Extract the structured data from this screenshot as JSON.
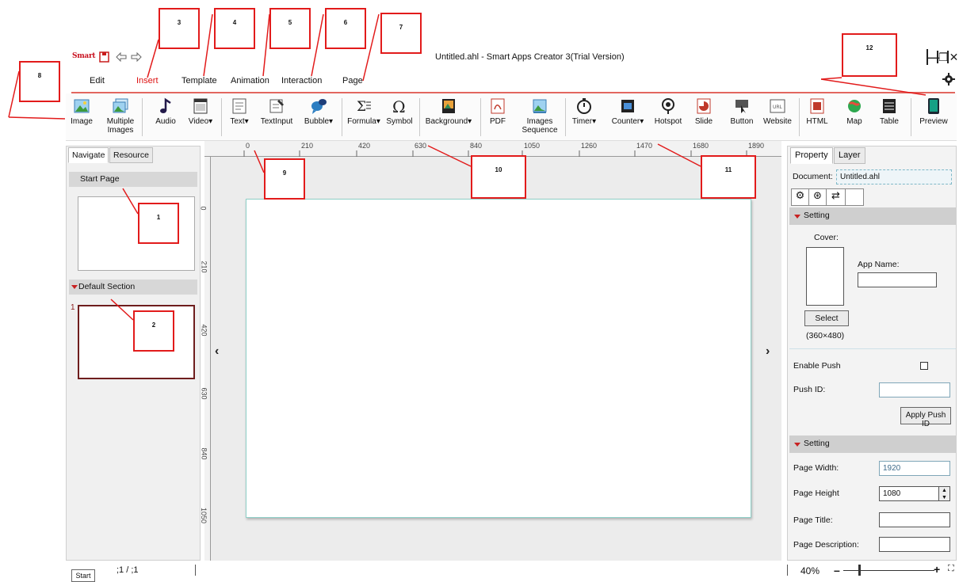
{
  "window": {
    "logo_text": "Smart",
    "title": "Untitled.ahl - Smart Apps Creator 3(Trial Version)",
    "controls": [
      "—",
      "❐",
      "✕"
    ]
  },
  "quick_access": [
    "save-icon",
    "undo-icon",
    "redo-icon"
  ],
  "menu_tabs": [
    {
      "label": "Edit",
      "active": false
    },
    {
      "label": "Insert",
      "active": true
    },
    {
      "label": "Template",
      "active": false
    },
    {
      "label": "Animation",
      "active": false
    },
    {
      "label": "Interaction",
      "active": false
    },
    {
      "label": "Page",
      "active": false
    }
  ],
  "toolbar": [
    {
      "label": "Image",
      "icon": "image-icon"
    },
    {
      "label": "Multiple\nImages",
      "icon": "multiple-images-icon"
    },
    {
      "label": "Audio",
      "icon": "audio-icon"
    },
    {
      "label": "Video▾",
      "icon": "video-icon"
    },
    {
      "label": "Text▾",
      "icon": "text-icon"
    },
    {
      "label": "TextInput",
      "icon": "text-input-icon"
    },
    {
      "label": "Bubble▾",
      "icon": "bubble-icon"
    },
    {
      "label": "Formula▾",
      "icon": "formula-icon"
    },
    {
      "label": "Symbol",
      "icon": "symbol-icon"
    },
    {
      "label": "Background▾",
      "icon": "background-icon"
    },
    {
      "label": "PDF",
      "icon": "pdf-icon"
    },
    {
      "label": "Images\nSequence",
      "icon": "images-sequence-icon"
    },
    {
      "label": "Timer▾",
      "icon": "timer-icon"
    },
    {
      "label": "Counter▾",
      "icon": "counter-icon"
    },
    {
      "label": "Hotspot",
      "icon": "hotspot-icon"
    },
    {
      "label": "Slide",
      "icon": "slide-icon"
    },
    {
      "label": "Button",
      "icon": "button-icon"
    },
    {
      "label": "Website",
      "icon": "website-icon"
    },
    {
      "label": "HTML",
      "icon": "html-icon"
    },
    {
      "label": "Map",
      "icon": "map-icon"
    },
    {
      "label": "Table",
      "icon": "table-icon"
    },
    {
      "label": "Preview",
      "icon": "preview-icon"
    }
  ],
  "ruler": {
    "horizontal": [
      "0",
      "210",
      "420",
      "630",
      "840",
      "1050",
      "1260",
      "1470",
      "1680",
      "1890"
    ],
    "vertical": [
      "0",
      "210",
      "420",
      "630",
      "840",
      "1050"
    ]
  },
  "left_panel": {
    "tabs": [
      "Navigate",
      "Resource"
    ],
    "start_page_label": "Start Page",
    "section_label": "Default Section",
    "page_number": "1"
  },
  "right_panel": {
    "tabs": [
      "Property",
      "Layer"
    ],
    "document_label": "Document:",
    "document_value": "Untitled.ahl",
    "setting_label": "Setting",
    "cover_label": "Cover:",
    "app_name_label": "App Name:",
    "select_label": "Select",
    "cover_size": "(360×480)",
    "enable_push_label": "Enable Push",
    "push_id_label": "Push ID:",
    "apply_push_label": "Apply Push ID",
    "setting2_label": "Setting",
    "page_width_label": "Page Width:",
    "page_width_value": "1920",
    "page_height_label": "Page Height",
    "page_height_value": "1080",
    "page_title_label": "Page Title:",
    "page_desc_label": "Page Description:"
  },
  "status": {
    "start_label": "Start",
    "page_counter": ";1 / ;1",
    "zoom": "40%"
  },
  "callouts": [
    "1",
    "2",
    "3",
    "4",
    "5",
    "6",
    "7",
    "8",
    "9",
    "10",
    "11",
    "12"
  ],
  "colors": {
    "accent_red": "#e21b1b",
    "tab_active": "#dd1111",
    "canvas_border": "#8fd0c8"
  }
}
